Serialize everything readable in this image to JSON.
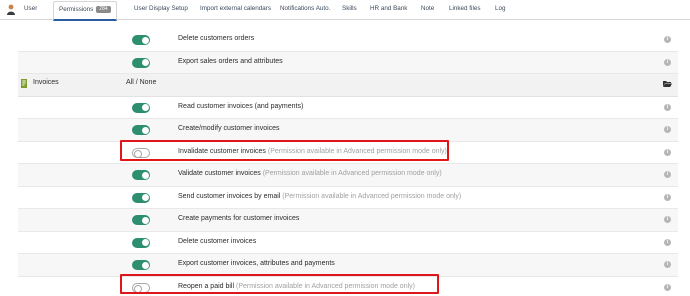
{
  "tabs": [
    {
      "label": "User",
      "active": false
    },
    {
      "label": "Permissions",
      "badge": "284",
      "active": true
    },
    {
      "label": "User Display Setup",
      "active": false
    },
    {
      "label": "Import external calendars",
      "active": false
    },
    {
      "label": "Notifications Auto.",
      "active": false
    },
    {
      "label": "Skills",
      "active": false
    },
    {
      "label": "HR and Bank",
      "active": false
    },
    {
      "label": "Note",
      "active": false
    },
    {
      "label": "Linked files",
      "active": false
    },
    {
      "label": "Log",
      "active": false
    }
  ],
  "orders_permissions": [
    {
      "label": "Delete customers orders",
      "enabled": true
    },
    {
      "label": "Export sales orders and attributes",
      "enabled": true
    }
  ],
  "section": {
    "title": "Invoices",
    "all_none": "All / None"
  },
  "invoice_permissions": [
    {
      "label": "Read customer invoices (and payments)",
      "enabled": true,
      "note": ""
    },
    {
      "label": "Create/modify customer invoices",
      "enabled": true,
      "note": ""
    },
    {
      "label": "Invalidate customer invoices",
      "enabled": false,
      "note": "(Permission available in Advanced permission mode only)",
      "highlighted": true
    },
    {
      "label": "Validate customer invoices",
      "enabled": true,
      "note": "(Permission available in Advanced permission mode only)"
    },
    {
      "label": "Send customer invoices by email",
      "enabled": true,
      "note": "(Permission available in Advanced permission mode only)"
    },
    {
      "label": "Create payments for customer invoices",
      "enabled": true,
      "note": ""
    },
    {
      "label": "Delete customer invoices",
      "enabled": true,
      "note": ""
    },
    {
      "label": "Export customer invoices, attributes and payments",
      "enabled": true,
      "note": ""
    },
    {
      "label": "Reopen a paid bill",
      "enabled": false,
      "note": "(Permission available in Advanced permission mode only)",
      "highlighted": true
    }
  ],
  "colors": {
    "toggle_on": "#2d8f6f",
    "highlight": "#e0161b",
    "active_tab": "#2a5d9f"
  }
}
